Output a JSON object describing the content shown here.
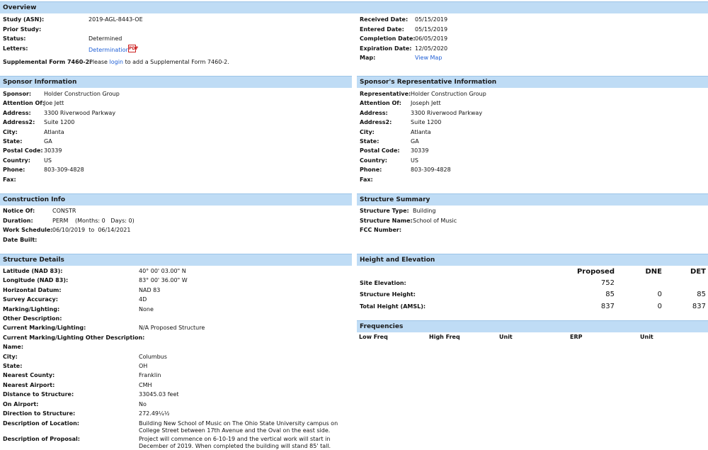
{
  "overview": {
    "title": "Overview",
    "left": [
      {
        "label": "Study (ASN):",
        "value": "2019-AGL-8443-OE"
      },
      {
        "label": "Prior Study:",
        "value": ""
      },
      {
        "label": "Status:",
        "value": "Determined"
      },
      {
        "label": "Letters:",
        "value": "Determination"
      }
    ],
    "supplemental": {
      "label": "Supplemental Form 7460-2:",
      "pre": "Please",
      "link": "login",
      "post": "to add a Supplemental Form 7460-2."
    },
    "right": [
      {
        "label": "Received Date:",
        "value": "05/15/2019"
      },
      {
        "label": "Entered Date:",
        "value": "05/15/2019"
      },
      {
        "label": "Completion Date:",
        "value": "06/05/2019"
      },
      {
        "label": "Expiration Date:",
        "value": "12/05/2020"
      },
      {
        "label": "Map:",
        "value": "View Map"
      }
    ]
  },
  "sponsor": {
    "title": "Sponsor Information",
    "rows": [
      {
        "label": "Sponsor:",
        "value": "Holder Construction Group"
      },
      {
        "label": "Attention Of:",
        "value": "Joe Jett"
      },
      {
        "label": "Address:",
        "value": "3300 Riverwood Parkway"
      },
      {
        "label": "Address2:",
        "value": "Suite 1200"
      },
      {
        "label": "City:",
        "value": "Atlanta"
      },
      {
        "label": "State:",
        "value": "GA"
      },
      {
        "label": "Postal Code:",
        "value": "30339"
      },
      {
        "label": "Country:",
        "value": "US"
      },
      {
        "label": "Phone:",
        "value": "803-309-4828"
      },
      {
        "label": "Fax:",
        "value": ""
      }
    ]
  },
  "representative": {
    "title": "Sponsor's Representative Information",
    "rows": [
      {
        "label": "Representative:",
        "value": "Holder Construction Group"
      },
      {
        "label": "Attention Of:",
        "value": "Joseph Jett"
      },
      {
        "label": "Address:",
        "value": "3300 Riverwood Parkway"
      },
      {
        "label": "Address2:",
        "value": "Suite 1200"
      },
      {
        "label": "City:",
        "value": "Atlanta"
      },
      {
        "label": "State:",
        "value": "GA"
      },
      {
        "label": "Postal Code:",
        "value": "30339"
      },
      {
        "label": "Country:",
        "value": "US"
      },
      {
        "label": "Phone:",
        "value": "803-309-4828"
      },
      {
        "label": "Fax:",
        "value": ""
      }
    ]
  },
  "construction": {
    "title": "Construction Info",
    "notice_label": "Notice Of:",
    "notice_value": "CONSTR",
    "duration_label": "Duration:",
    "duration_value": "PERM",
    "duration_extra": "(Months: 0   Days: 0)",
    "schedule_label": "Work Schedule:",
    "schedule_value": "06/10/2019  to  06/14/2021",
    "built_label": "Date Built:",
    "built_value": ""
  },
  "summary": {
    "title": "Structure Summary",
    "rows": [
      {
        "label": "Structure Type:",
        "value": "Building"
      },
      {
        "label": "Structure Name:",
        "value": "School of Music"
      },
      {
        "label": "FCC Number:",
        "value": ""
      }
    ]
  },
  "details": {
    "title": "Structure Details",
    "rows": [
      {
        "label": "Latitude (NAD 83):",
        "value": "40° 00' 03.00\" N"
      },
      {
        "label": "Longitude (NAD 83):",
        "value": "83° 00' 36.00\" W"
      },
      {
        "label": "Horizontal Datum:",
        "value": "NAD 83"
      },
      {
        "label": "Survey Accuracy:",
        "value": "4D"
      },
      {
        "label": "Marking/Lighting:",
        "value": "None"
      },
      {
        "label": "Other Description:",
        "value": ""
      },
      {
        "label": "Current Marking/Lighting:",
        "value": "N/A Proposed Structure"
      },
      {
        "label": "Current Marking/Lighting Other Description:",
        "value": ""
      },
      {
        "label": "Name:",
        "value": ""
      },
      {
        "label": "City:",
        "value": "Columbus"
      },
      {
        "label": "State:",
        "value": "OH"
      },
      {
        "label": "Nearest County:",
        "value": "Franklin"
      },
      {
        "label": "Nearest Airport:",
        "value": "CMH"
      },
      {
        "label": "Distance to Structure:",
        "value": "33045.03 feet"
      },
      {
        "label": "On Airport:",
        "value": "No"
      },
      {
        "label": "Direction to Structure:",
        "value": "272.49¼½"
      }
    ],
    "location_label": "Description of Location:",
    "location_value": "Building New School of Music on The Ohio State University campus on College Street between 17th Avenue and the Oval on the east side.",
    "proposal_label": "Description of Proposal:",
    "proposal_value": "Project will commence on 6-10-19 and the vertical work will start in December of 2019. When completed the building will stand 85' tall."
  },
  "elevation": {
    "title": "Height and Elevation",
    "headers": [
      "Proposed",
      "DNE",
      "DET"
    ],
    "rows": [
      {
        "label": "Site Elevation:",
        "proposed": "752",
        "dne": "",
        "det": ""
      },
      {
        "label": "Structure Height:",
        "proposed": "85",
        "dne": "0",
        "det": "85"
      },
      {
        "label": "Total Height (AMSL):",
        "proposed": "837",
        "dne": "0",
        "det": "837"
      }
    ]
  },
  "frequencies": {
    "title": "Frequencies",
    "headers": [
      "Low Freq",
      "High Freq",
      "Unit",
      "ERP",
      "Unit"
    ]
  },
  "colors": {
    "header_bg": "#bfdcf5",
    "link": "#1f5fd6"
  },
  "icons": {
    "letter_icon": "pdf-icon"
  }
}
